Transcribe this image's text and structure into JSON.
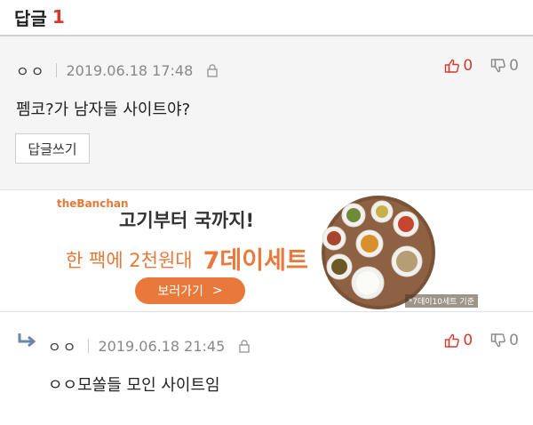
{
  "header": {
    "title": "답글",
    "count": "1"
  },
  "comments": [
    {
      "author": "ㅇㅇ",
      "date": "2019.06.18 17:48",
      "upvotes": "0",
      "downvotes": "0",
      "content": "펨코?가 남자들 사이트야?",
      "reply_button": "답글쓰기"
    },
    {
      "author": "ㅇㅇ",
      "date": "2019.06.18 21:45",
      "upvotes": "0",
      "downvotes": "0",
      "content": "ㅇㅇ모쏠들 모인 사이트임"
    }
  ],
  "banner": {
    "brand": "theBanchan",
    "headline": "고기부터 국까지!",
    "subline": "한 팩에 2천원대",
    "highlight": "7데이세트",
    "cta": "보러가기",
    "cta_chevron": ">",
    "note": "*7데이10세트 기준"
  },
  "colors": {
    "accent_red": "#d13b2c",
    "banner_orange": "#e8793a"
  }
}
